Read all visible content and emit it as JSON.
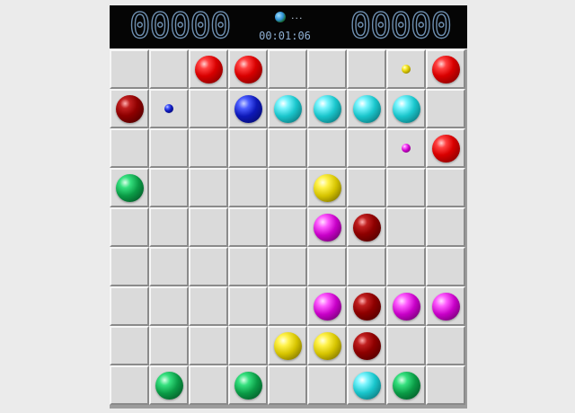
{
  "header": {
    "score_left": "00000",
    "score_right": "00000",
    "timer": "00:01:06",
    "status_dots": "..."
  },
  "colors": {
    "red": "#d90000",
    "darkred": "#8e0000",
    "blue": "#0d18b8",
    "cyan": "#19c6cc",
    "green": "#0a9a45",
    "yellow": "#d6c400",
    "magenta": "#c800c8",
    "cell": "#dadada",
    "header_bg": "#050505"
  },
  "board": {
    "rows": 9,
    "cols": 9,
    "grid": [
      [
        "",
        "",
        "red",
        "red",
        "",
        "",
        "",
        "yellow-small",
        "red"
      ],
      [
        "darkred",
        "blue-small",
        "",
        "blue",
        "cyan",
        "cyan",
        "cyan",
        "cyan",
        ""
      ],
      [
        "",
        "",
        "",
        "",
        "",
        "",
        "",
        "magenta-small",
        "red"
      ],
      [
        "green",
        "",
        "",
        "",
        "",
        "yellow",
        "",
        "",
        ""
      ],
      [
        "",
        "",
        "",
        "",
        "",
        "magenta",
        "darkred",
        "",
        ""
      ],
      [
        "",
        "",
        "",
        "",
        "",
        "",
        "",
        "",
        ""
      ],
      [
        "",
        "",
        "",
        "",
        "",
        "magenta",
        "darkred",
        "magenta",
        "magenta"
      ],
      [
        "",
        "",
        "",
        "",
        "yellow",
        "yellow",
        "darkred",
        "",
        ""
      ],
      [
        "",
        "green",
        "",
        "green",
        "",
        "",
        "cyan",
        "green",
        ""
      ]
    ]
  }
}
